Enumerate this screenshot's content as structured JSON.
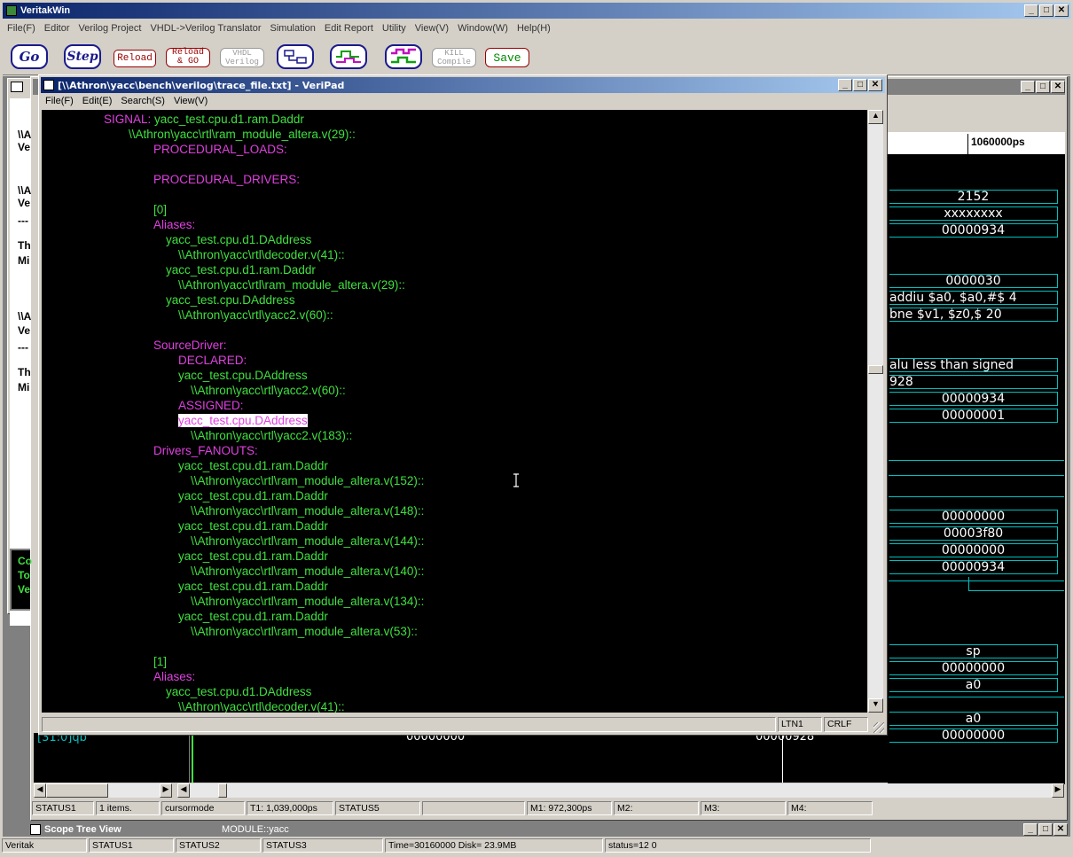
{
  "main_window": {
    "title": "VeritakWin",
    "menu": [
      "File(F)",
      "Editor",
      "Verilog Project",
      "VHDL->Verilog Translator",
      "Simulation",
      "Edit Report",
      "Utility",
      "View(V)",
      "Window(W)",
      "Help(H)"
    ]
  },
  "toolbar": {
    "go": "Go",
    "step": "Step",
    "reload": "Reload",
    "reload_go_1": "Reload",
    "reload_go_2": "& GO",
    "vhdl_1": "VHDL",
    "vhdl_2": "Verilog",
    "kill_1": "KILL",
    "kill_2": "Compile",
    "save": "Save"
  },
  "left_panel": {
    "lines": [
      "\\\\A",
      "Ve",
      "\\\\A",
      "Ve",
      "---",
      "Th",
      "Mi",
      "\\\\A",
      "Ve",
      "---",
      "Th",
      "Mi"
    ],
    "green_lines": [
      "Co",
      "To",
      "Ve"
    ]
  },
  "veripad": {
    "title": "[\\\\Athron\\yacc\\bench\\verilog\\trace_file.txt] - VeriPad",
    "menu": [
      "File(F)",
      "Edit(E)",
      "Search(S)",
      "View(V)"
    ],
    "status_line": "LTN1",
    "status_eol": "CRLF",
    "lines": [
      {
        "indent": 0,
        "parts": [
          {
            "t": "SIGNAL: ",
            "c": "mag"
          },
          {
            "t": "yacc_test.cpu.d1.ram.Daddr",
            "c": "grn"
          }
        ]
      },
      {
        "indent": 1,
        "parts": [
          {
            "t": "\\\\Athron\\yacc\\rtl\\ram_module_altera.v(29)::",
            "c": "grn"
          }
        ]
      },
      {
        "indent": 2,
        "parts": [
          {
            "t": "PROCEDURAL_LOADS:",
            "c": "mag"
          }
        ]
      },
      {
        "indent": 0,
        "parts": []
      },
      {
        "indent": 2,
        "parts": [
          {
            "t": "PROCEDURAL_DRIVERS:",
            "c": "mag"
          }
        ]
      },
      {
        "indent": 0,
        "parts": []
      },
      {
        "indent": 2,
        "parts": [
          {
            "t": "[0]",
            "c": "grn"
          }
        ]
      },
      {
        "indent": 2,
        "parts": [
          {
            "t": "Aliases:",
            "c": "mag"
          }
        ]
      },
      {
        "indent": 3,
        "parts": [
          {
            "t": "yacc_test.cpu.d1.DAddress",
            "c": "grn"
          }
        ]
      },
      {
        "indent": 4,
        "parts": [
          {
            "t": "\\\\Athron\\yacc\\rtl\\decoder.v(41)::",
            "c": "grn"
          }
        ]
      },
      {
        "indent": 3,
        "parts": [
          {
            "t": "yacc_test.cpu.d1.ram.Daddr",
            "c": "grn"
          }
        ]
      },
      {
        "indent": 4,
        "parts": [
          {
            "t": "\\\\Athron\\yacc\\rtl\\ram_module_altera.v(29)::",
            "c": "grn"
          }
        ]
      },
      {
        "indent": 3,
        "parts": [
          {
            "t": "yacc_test.cpu.DAddress",
            "c": "grn"
          }
        ]
      },
      {
        "indent": 4,
        "parts": [
          {
            "t": "\\\\Athron\\yacc\\rtl\\yacc2.v(60)::",
            "c": "grn"
          }
        ]
      },
      {
        "indent": 0,
        "parts": []
      },
      {
        "indent": 2,
        "parts": [
          {
            "t": "SourceDriver:",
            "c": "mag"
          }
        ]
      },
      {
        "indent": 4,
        "parts": [
          {
            "t": "DECLARED:",
            "c": "mag"
          }
        ]
      },
      {
        "indent": 4,
        "parts": [
          {
            "t": "yacc_test.cpu.DAddress",
            "c": "grn"
          }
        ]
      },
      {
        "indent": 5,
        "parts": [
          {
            "t": "\\\\Athron\\yacc\\rtl\\yacc2.v(60)::",
            "c": "grn"
          }
        ]
      },
      {
        "indent": 4,
        "parts": [
          {
            "t": "ASSIGNED:",
            "c": "mag"
          }
        ]
      },
      {
        "indent": 4,
        "parts": [
          {
            "t": "yacc_test.cpu.DAddress",
            "c": "sel"
          }
        ]
      },
      {
        "indent": 5,
        "parts": [
          {
            "t": "\\\\Athron\\yacc\\rtl\\yacc2.v(183)::",
            "c": "grn"
          }
        ]
      },
      {
        "indent": 2,
        "parts": [
          {
            "t": "Drivers_FANOUTS:",
            "c": "mag"
          }
        ]
      },
      {
        "indent": 4,
        "parts": [
          {
            "t": "yacc_test.cpu.d1.ram.Daddr",
            "c": "grn"
          }
        ]
      },
      {
        "indent": 5,
        "parts": [
          {
            "t": "\\\\Athron\\yacc\\rtl\\ram_module_altera.v(152)::",
            "c": "grn"
          }
        ]
      },
      {
        "indent": 4,
        "parts": [
          {
            "t": "yacc_test.cpu.d1.ram.Daddr",
            "c": "grn"
          }
        ]
      },
      {
        "indent": 5,
        "parts": [
          {
            "t": "\\\\Athron\\yacc\\rtl\\ram_module_altera.v(148)::",
            "c": "grn"
          }
        ]
      },
      {
        "indent": 4,
        "parts": [
          {
            "t": "yacc_test.cpu.d1.ram.Daddr",
            "c": "grn"
          }
        ]
      },
      {
        "indent": 5,
        "parts": [
          {
            "t": "\\\\Athron\\yacc\\rtl\\ram_module_altera.v(144)::",
            "c": "grn"
          }
        ]
      },
      {
        "indent": 4,
        "parts": [
          {
            "t": "yacc_test.cpu.d1.ram.Daddr",
            "c": "grn"
          }
        ]
      },
      {
        "indent": 5,
        "parts": [
          {
            "t": "\\\\Athron\\yacc\\rtl\\ram_module_altera.v(140)::",
            "c": "grn"
          }
        ]
      },
      {
        "indent": 4,
        "parts": [
          {
            "t": "yacc_test.cpu.d1.ram.Daddr",
            "c": "grn"
          }
        ]
      },
      {
        "indent": 5,
        "parts": [
          {
            "t": "\\\\Athron\\yacc\\rtl\\ram_module_altera.v(134)::",
            "c": "grn"
          }
        ]
      },
      {
        "indent": 4,
        "parts": [
          {
            "t": "yacc_test.cpu.d1.ram.Daddr",
            "c": "grn"
          }
        ]
      },
      {
        "indent": 5,
        "parts": [
          {
            "t": "\\\\Athron\\yacc\\rtl\\ram_module_altera.v(53)::",
            "c": "grn"
          }
        ]
      },
      {
        "indent": 0,
        "parts": []
      },
      {
        "indent": 2,
        "parts": [
          {
            "t": "[1]",
            "c": "grn"
          }
        ]
      },
      {
        "indent": 2,
        "parts": [
          {
            "t": "Aliases:",
            "c": "mag"
          }
        ]
      },
      {
        "indent": 3,
        "parts": [
          {
            "t": "yacc_test.cpu.d1.DAddress",
            "c": "grn"
          }
        ]
      },
      {
        "indent": 4,
        "parts": [
          {
            "t": "\\\\Athron\\yacc\\rtl\\decoder.v(41)::",
            "c": "grn"
          }
        ]
      }
    ]
  },
  "wave_window": {
    "time_marker": "1060000ps",
    "values": [
      "2152",
      "xxxxxxxx",
      "00000934",
      "0000030",
      "addiu  $a0, $a0,#$    4",
      "bne  $v1, $z0,$      20",
      "alu  less  than  signed",
      "928",
      "00000934",
      "00000001",
      "00000000",
      "00003f80",
      "00000000",
      "00000934",
      "sp",
      "00000000",
      "a0",
      "a0",
      "00000000"
    ],
    "bottom_signal": "[31:0]qb",
    "bottom_values": [
      "00000000",
      "00000928"
    ]
  },
  "wave_status": [
    "STATUS1",
    "1 items.",
    "cursormode",
    "T1: 1,039,000ps",
    "STATUS5",
    "",
    "M1: 972,300ps",
    "M2:",
    "M3:",
    "M4:"
  ],
  "scope_tree": {
    "title": "Scope Tree View",
    "module": "MODULE::yacc"
  },
  "main_status": [
    "Veritak",
    "STATUS1",
    "STATUS2",
    "STATUS3",
    "Time=30160000 Disk= 23.9MB",
    "status=12 0"
  ],
  "colors": {
    "titlebar": "#0a246a",
    "magenta": "#e040e0",
    "green": "#40e040",
    "wave": "#00c0c0"
  }
}
